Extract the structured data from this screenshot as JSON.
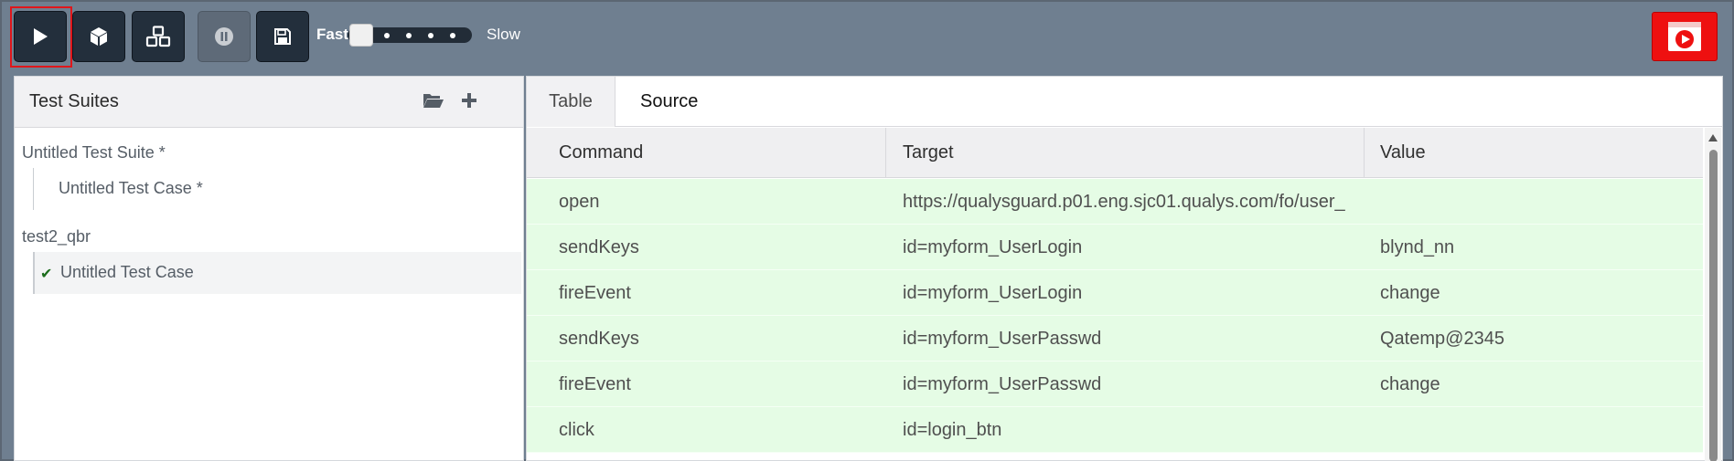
{
  "toolbar": {
    "buttons": [
      {
        "icon": "play-icon"
      },
      {
        "icon": "cube-icon"
      },
      {
        "icon": "cubes-icon"
      },
      {
        "icon": "pause-icon",
        "disabled": true
      },
      {
        "icon": "save-icon"
      }
    ],
    "speed": {
      "fast_label": "Fast",
      "slow_label": "Slow",
      "level": 0
    },
    "record_icon": "record-icon",
    "accent_color": "#ee1010"
  },
  "left_panel": {
    "title": "Test Suites",
    "icons": [
      "folder-open-icon",
      "plus-icon"
    ],
    "suites": [
      {
        "name": "Untitled Test Suite *",
        "cases": [
          {
            "name": "Untitled Test Case *",
            "selected": false,
            "passed": false
          }
        ]
      },
      {
        "name": "test2_qbr",
        "cases": [
          {
            "name": "Untitled Test Case",
            "selected": true,
            "passed": true
          }
        ]
      }
    ]
  },
  "right_panel": {
    "tabs": [
      {
        "label": "Table",
        "active": true
      },
      {
        "label": "Source",
        "active": false
      }
    ],
    "columns": [
      "Command",
      "Target",
      "Value"
    ],
    "rows": [
      {
        "command": "open",
        "target": "https://qualysguard.p01.eng.sjc01.qualys.com/fo/user_",
        "value": ""
      },
      {
        "command": "sendKeys",
        "target": "id=myform_UserLogin",
        "value": "blynd_nn"
      },
      {
        "command": "fireEvent",
        "target": "id=myform_UserLogin",
        "value": "change"
      },
      {
        "command": "sendKeys",
        "target": "id=myform_UserPasswd",
        "value": "Qatemp@2345"
      },
      {
        "command": "fireEvent",
        "target": "id=myform_UserPasswd",
        "value": "change"
      },
      {
        "command": "click",
        "target": "id=login_btn",
        "value": ""
      }
    ],
    "row_color": "#e5fce5"
  }
}
